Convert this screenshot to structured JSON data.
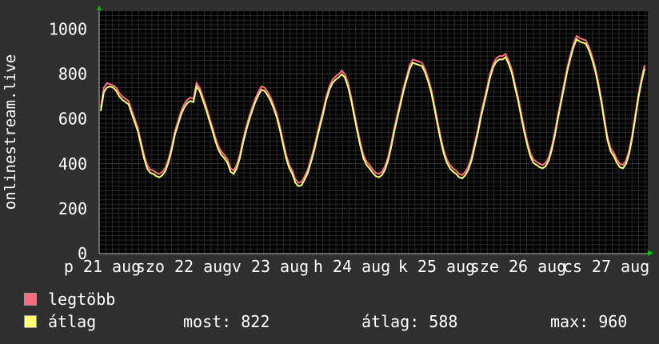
{
  "chart_data": {
    "type": "line",
    "ylabel": "onlinestream.live",
    "yticks": [
      0,
      200,
      400,
      600,
      800,
      1000
    ],
    "ylim": [
      0,
      1080
    ],
    "x_tick_labels": [
      "p 21 aug",
      "szo 22 aug",
      "v 23 aug",
      "h 24 aug",
      "k 25 aug",
      "sze 26 aug",
      "cs 27 aug"
    ],
    "colors": {
      "background": "#2f2f2f",
      "plot_bg": "#000000",
      "grid": "#3a3a3a",
      "max_line": "#ff6b7a",
      "avg_line": "#ffff70",
      "axis_arrow": "#00cc00"
    },
    "series": [
      {
        "name": "legtöbb",
        "values": [
          650,
          740,
          760,
          755,
          750,
          740,
          715,
          700,
          690,
          680,
          640,
          600,
          560,
          500,
          440,
          395,
          375,
          370,
          360,
          355,
          365,
          385,
          425,
          480,
          545,
          590,
          635,
          665,
          685,
          695,
          690,
          760,
          740,
          700,
          660,
          615,
          570,
          520,
          480,
          455,
          440,
          420,
          380,
          370,
          395,
          440,
          505,
          560,
          610,
          650,
          690,
          720,
          745,
          740,
          720,
          695,
          660,
          620,
          565,
          500,
          440,
          395,
          370,
          330,
          315,
          320,
          345,
          375,
          420,
          470,
          530,
          585,
          640,
          700,
          745,
          775,
          790,
          800,
          815,
          800,
          760,
          700,
          630,
          560,
          495,
          440,
          410,
          395,
          375,
          360,
          355,
          365,
          390,
          430,
          490,
          560,
          620,
          680,
          740,
          790,
          840,
          865,
          860,
          855,
          850,
          820,
          780,
          730,
          660,
          590,
          520,
          460,
          420,
          395,
          380,
          370,
          355,
          350,
          365,
          390,
          430,
          490,
          550,
          620,
          680,
          740,
          800,
          845,
          870,
          880,
          880,
          890,
          860,
          820,
          760,
          700,
          630,
          560,
          500,
          450,
          420,
          410,
          400,
          395,
          405,
          430,
          480,
          545,
          620,
          690,
          760,
          830,
          885,
          935,
          970,
          960,
          955,
          950,
          920,
          880,
          830,
          765,
          690,
          600,
          520,
          470,
          450,
          420,
          400,
          395,
          415,
          460,
          530,
          620,
          710,
          780,
          840
        ],
        "color": "#ff6b7a"
      },
      {
        "name": "átlag",
        "values": [
          635,
          720,
          740,
          745,
          740,
          725,
          700,
          685,
          675,
          665,
          625,
          585,
          545,
          485,
          425,
          380,
          360,
          355,
          345,
          340,
          350,
          370,
          410,
          465,
          530,
          575,
          620,
          650,
          670,
          680,
          675,
          745,
          725,
          685,
          645,
          600,
          555,
          505,
          465,
          440,
          425,
          405,
          365,
          355,
          380,
          425,
          490,
          545,
          595,
          635,
          675,
          705,
          730,
          725,
          705,
          680,
          645,
          605,
          550,
          485,
          425,
          380,
          355,
          315,
          300,
          305,
          330,
          360,
          405,
          455,
          515,
          570,
          625,
          685,
          730,
          760,
          775,
          785,
          800,
          785,
          745,
          685,
          615,
          545,
          480,
          425,
          395,
          380,
          360,
          345,
          340,
          350,
          375,
          415,
          475,
          545,
          605,
          665,
          725,
          775,
          825,
          850,
          845,
          840,
          835,
          805,
          765,
          715,
          645,
          575,
          505,
          445,
          405,
          380,
          365,
          355,
          340,
          335,
          350,
          375,
          415,
          475,
          535,
          605,
          665,
          725,
          785,
          830,
          855,
          865,
          865,
          875,
          845,
          805,
          745,
          685,
          615,
          545,
          485,
          435,
          405,
          395,
          385,
          380,
          390,
          415,
          465,
          530,
          605,
          675,
          745,
          815,
          870,
          920,
          955,
          945,
          940,
          935,
          905,
          865,
          815,
          750,
          675,
          585,
          505,
          455,
          435,
          405,
          385,
          380,
          400,
          445,
          515,
          605,
          695,
          765,
          825
        ],
        "color": "#ffff70"
      }
    ],
    "legend": [
      {
        "label": "legtöbb",
        "color": "#ff6b7a"
      },
      {
        "label": "átlag",
        "color": "#ffff70"
      }
    ],
    "stats": {
      "most": "most: 822",
      "atlag": "átlag: 588",
      "max": "max: 960"
    }
  }
}
